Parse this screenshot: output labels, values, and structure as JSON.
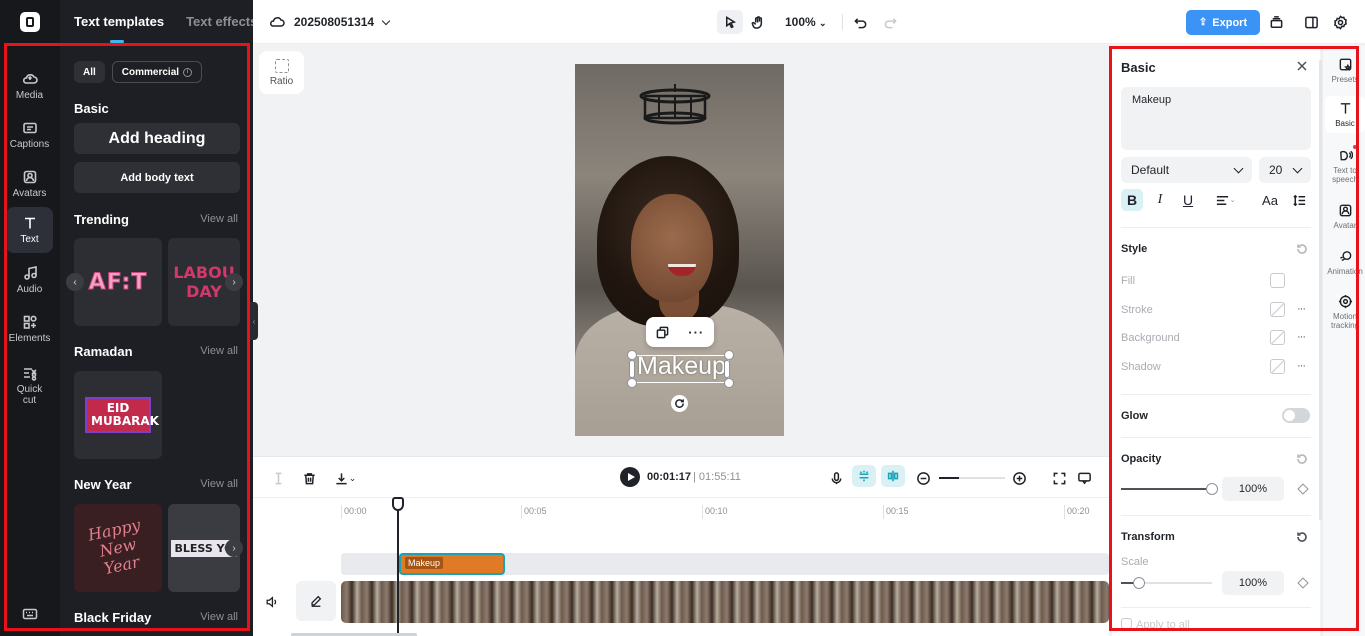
{
  "left_rail": {
    "items": [
      {
        "label": "Media",
        "icon": "cloud-upload-icon"
      },
      {
        "label": "Captions",
        "icon": "captions-icon"
      },
      {
        "label": "Avatars",
        "icon": "avatar-icon"
      },
      {
        "label": "Text",
        "icon": "text-icon"
      },
      {
        "label": "Audio",
        "icon": "music-note-icon"
      },
      {
        "label": "Elements",
        "icon": "elements-icon"
      },
      {
        "label": "Quick cut",
        "icon": "quick-cut-icon"
      }
    ]
  },
  "left_panel": {
    "tabs": [
      "Text templates",
      "Text effects"
    ],
    "filters": [
      "All",
      "Commercial"
    ],
    "basic": {
      "title": "Basic",
      "add_heading": "Add heading",
      "add_body": "Add body text"
    },
    "view_all": "View all",
    "sections": [
      {
        "title": "Trending",
        "thumbs": [
          "AF:T",
          "LABOU DAY"
        ]
      },
      {
        "title": "Ramadan",
        "thumbs": [
          "EID MUBARAK"
        ]
      },
      {
        "title": "New Year",
        "thumbs": [
          "Happy New Year",
          "BLESS YO"
        ]
      },
      {
        "title": "Black Friday",
        "thumbs": []
      }
    ]
  },
  "topbar": {
    "project_name": "202508051314",
    "zoom": "100%",
    "export_label": "Export"
  },
  "canvas": {
    "ratio_label": "Ratio",
    "selected_text": "Makeup"
  },
  "timeline": {
    "current_time": "00:01:17",
    "total_time": "01:55:11",
    "ticks": [
      "00:00",
      "00:05",
      "00:10",
      "00:15",
      "00:20"
    ],
    "text_clip_label": "Makeup"
  },
  "props": {
    "title": "Basic",
    "text_value": "Makeup",
    "font": "Default",
    "font_size": "20",
    "style_title": "Style",
    "style_rows": [
      "Fill",
      "Stroke",
      "Background",
      "Shadow"
    ],
    "glow_title": "Glow",
    "opacity_title": "Opacity",
    "opacity_value": "100%",
    "transform_title": "Transform",
    "scale_label": "Scale",
    "scale_value": "100%",
    "apply_all": "Apply to all"
  },
  "right_rail": {
    "items": [
      {
        "label": "Presets",
        "icon": "presets-icon"
      },
      {
        "label": "Basic",
        "icon": "text-basic-icon"
      },
      {
        "label": "Text to speech",
        "icon": "text-to-speech-icon"
      },
      {
        "label": "Avatar",
        "icon": "avatar-icon"
      },
      {
        "label": "Animation",
        "icon": "animation-icon"
      },
      {
        "label": "Motion tracking",
        "icon": "motion-tracking-icon"
      }
    ]
  },
  "colors": {
    "accent": "#3a93f5",
    "teal": "#19a2b8",
    "annotation_red": "#e8121b",
    "clip_orange": "#e07a24"
  }
}
